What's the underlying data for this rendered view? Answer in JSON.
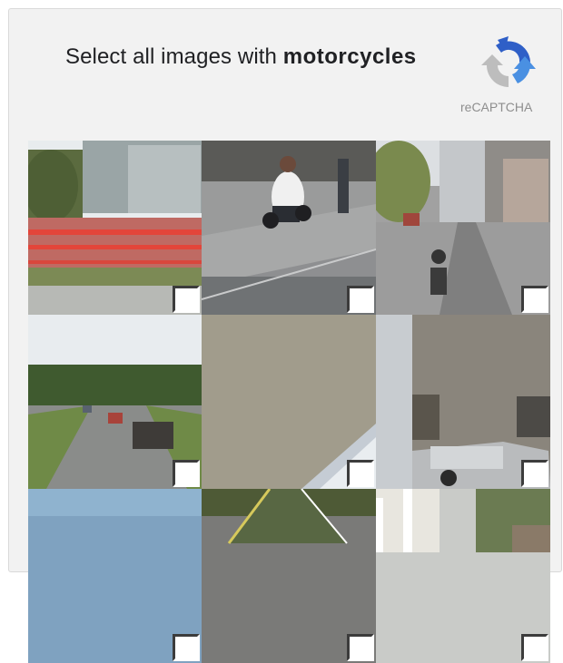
{
  "prompt": {
    "prefix": "Select all images with",
    "target": "motorcycles"
  },
  "brand": {
    "label": "reCAPTCHA",
    "icon": "recaptcha-logo-icon"
  },
  "tiles": [
    {
      "scene": "bridge-with-red-railing",
      "selected": false
    },
    {
      "scene": "man-on-scooter-sidewalk",
      "selected": false
    },
    {
      "scene": "street-with-motorcycle-rider",
      "selected": false
    },
    {
      "scene": "highway-with-cars",
      "selected": false
    },
    {
      "scene": "gravel-ground",
      "selected": false
    },
    {
      "scene": "building-with-pickup-truck",
      "selected": false
    },
    {
      "scene": "beach-with-water",
      "selected": false
    },
    {
      "scene": "divided-road",
      "selected": false
    },
    {
      "scene": "street-with-houses",
      "selected": false
    }
  ],
  "colors": {
    "card_bg": "#f2f2f2",
    "text": "#202124",
    "brand_text": "#8e8e8e",
    "logo_blue": "#4a90e2",
    "logo_gray": "#bdbdbd"
  }
}
